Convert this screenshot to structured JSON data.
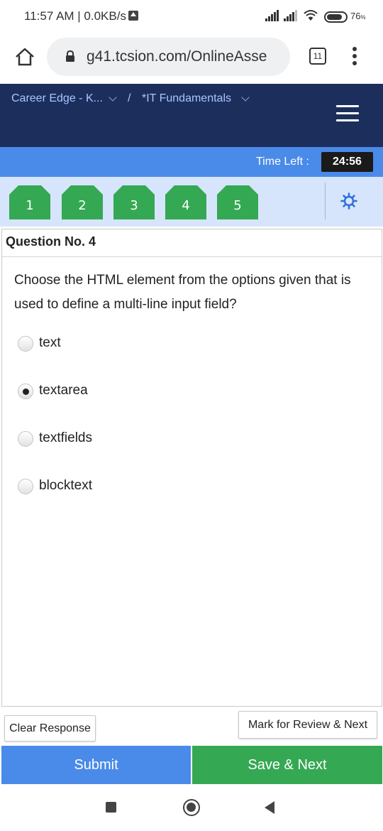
{
  "status_bar": {
    "time": "11:57 AM | 0.0KB/s",
    "battery": "76"
  },
  "browser": {
    "url": "g41.tcsion.com/OnlineAsse",
    "tab_count": "11"
  },
  "header": {
    "breadcrumb_1": "Career Edge - K...",
    "separator": "/",
    "breadcrumb_2": "*IT Fundamentals"
  },
  "timer": {
    "label": "Time Left :",
    "value": "24:56"
  },
  "question_palette": {
    "items": [
      {
        "label": "1",
        "color": "#35a853"
      },
      {
        "label": "2",
        "color": "#35a853"
      },
      {
        "label": "3",
        "color": "#35a853"
      },
      {
        "label": "4",
        "color": "#35a853"
      },
      {
        "label": "5",
        "color": "#35a853"
      }
    ]
  },
  "question": {
    "title": "Question No. 4",
    "text": "Choose the HTML element from the options given that is used to define a multi-line input field?",
    "options": [
      {
        "label": "text",
        "selected": false
      },
      {
        "label": "textarea",
        "selected": true
      },
      {
        "label": "textfields",
        "selected": false
      },
      {
        "label": "blocktext",
        "selected": false
      }
    ]
  },
  "actions": {
    "clear": "Clear Response",
    "review": "Mark for Review & Next",
    "submit": "Submit",
    "save": "Save & Next"
  },
  "colors": {
    "header_bg": "#1c2e5c",
    "timer_bg": "#4a8ae8",
    "palette_bg": "#d6e5fb",
    "answered_green": "#35a853",
    "submit_blue": "#4a8ae8"
  }
}
